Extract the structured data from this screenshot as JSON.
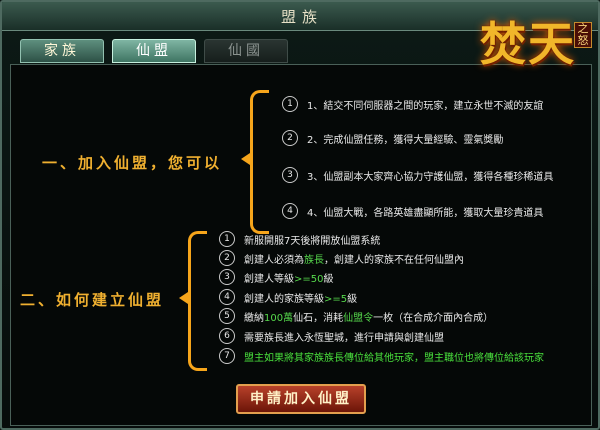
{
  "window": {
    "title": "盟族"
  },
  "tabs": [
    {
      "label": "家族",
      "state": "normal"
    },
    {
      "label": "仙盟",
      "state": "active"
    },
    {
      "label": "仙國",
      "state": "disabled"
    }
  ],
  "logo": {
    "text": "焚天",
    "sub": "之怒"
  },
  "section1": {
    "heading": "一、加入仙盟，您可以",
    "items": [
      {
        "num": "1",
        "text": "1、結交不同伺服器之間的玩家，建立永世不滅的友誼"
      },
      {
        "num": "2",
        "text": "2、完成仙盟任務，獲得大量經驗、靈氣獎勵"
      },
      {
        "num": "3",
        "text": "3、仙盟副本大家齊心協力守護仙盟，獲得各種珍稀道具"
      },
      {
        "num": "4",
        "text": "4、仙盟大戰，各路英雄盡顯所能，獲取大量珍貴道具"
      }
    ]
  },
  "section2": {
    "heading": "二、如何建立仙盟",
    "items": [
      {
        "num": "1",
        "a": "新服開服7天後將開放仙盟系統",
        "b": "",
        "c": ""
      },
      {
        "num": "2",
        "a": "創建人必須為",
        "b": "族長",
        "c": "，創建人的家族不在任何仙盟內"
      },
      {
        "num": "3",
        "a": "創建人等級",
        "b": ">=50",
        "c": "級"
      },
      {
        "num": "4",
        "a": "創建人的家族等級",
        "b": ">=5",
        "c": "級"
      },
      {
        "num": "5",
        "a": "繳納",
        "b": "100萬",
        "c": "仙石，消耗",
        "d": "仙盟令",
        "e": "一枚（在合成介面內合成）"
      },
      {
        "num": "6",
        "a": "需要族長進入永恆聖城，進行申請與創建仙盟",
        "b": "",
        "c": ""
      },
      {
        "num": "7",
        "a": "",
        "b": "盟主如果將其家族族長傳位給其他玩家，盟主職位也將傳位給該玩家",
        "c": ""
      }
    ]
  },
  "apply_button": {
    "label": "申請加入仙盟"
  },
  "colors": {
    "accent": "#f6a51b",
    "highlight": "#56d94c"
  }
}
